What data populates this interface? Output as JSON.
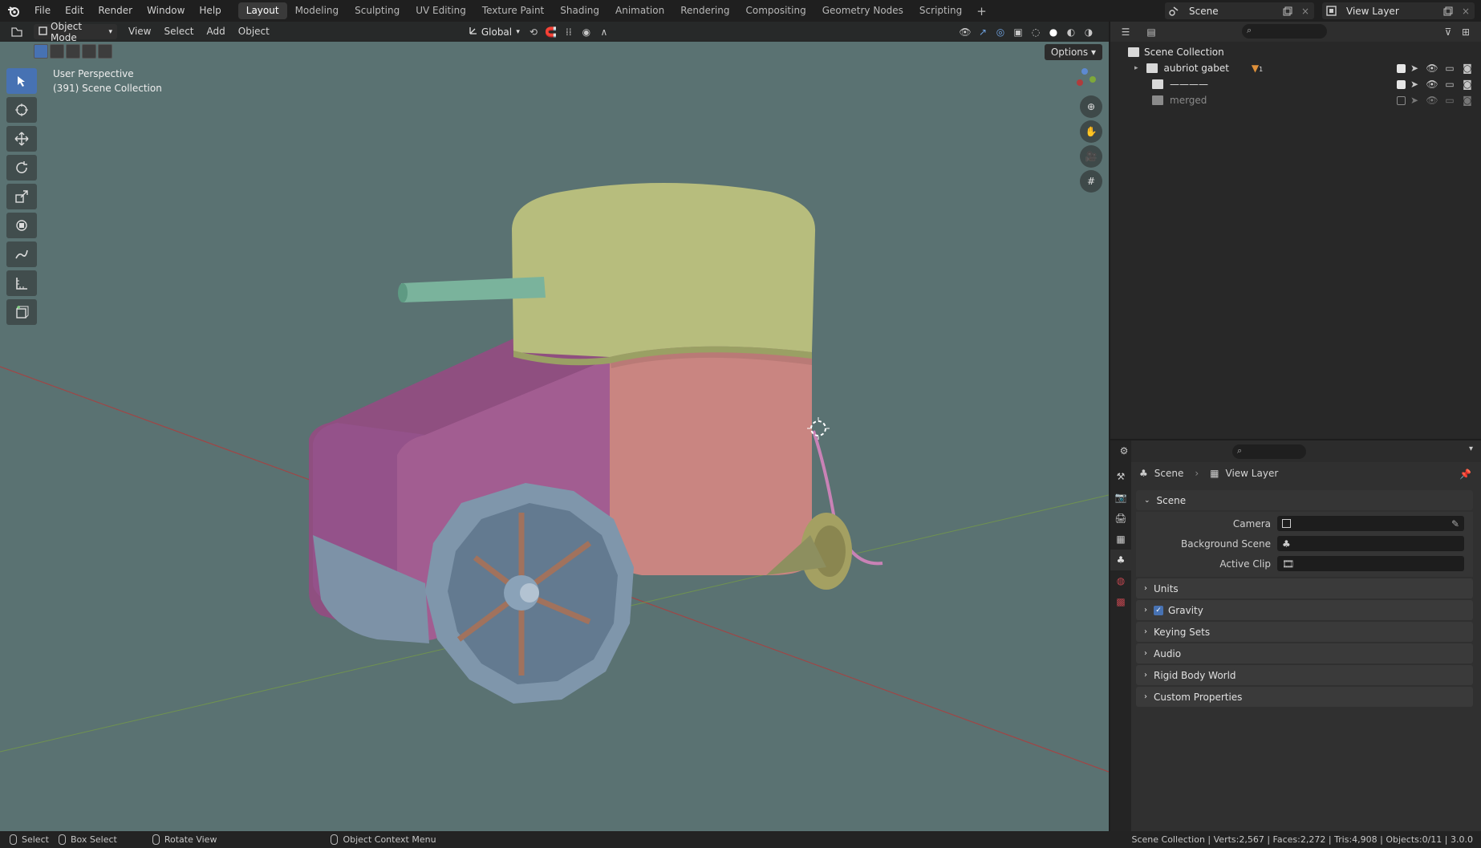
{
  "topbar": {
    "menus": [
      "File",
      "Edit",
      "Render",
      "Window",
      "Help"
    ],
    "workspaces": [
      "Layout",
      "Modeling",
      "Sculpting",
      "UV Editing",
      "Texture Paint",
      "Shading",
      "Animation",
      "Rendering",
      "Compositing",
      "Geometry Nodes",
      "Scripting"
    ],
    "active_workspace": "Layout",
    "add_tab": "+",
    "scene": "Scene",
    "view_layer": "View Layer"
  },
  "viewport": {
    "mode": "Object Mode",
    "menus": [
      "View",
      "Select",
      "Add",
      "Object"
    ],
    "orientation": "Global",
    "options": "Options",
    "perspective": "User Perspective",
    "collection_info": "(391) Scene Collection",
    "background": "#5a7272"
  },
  "outliner": {
    "root": "Scene Collection",
    "items": [
      {
        "name": "aubriot gabet",
        "visible": true,
        "badge": "1"
      },
      {
        "name": "————",
        "visible": true
      },
      {
        "name": "merged",
        "visible": false
      }
    ]
  },
  "properties": {
    "breadcrumb": {
      "scene": "Scene",
      "view_layer": "View Layer"
    },
    "scene_panel": "Scene",
    "fields": [
      {
        "label": "Camera",
        "value": ""
      },
      {
        "label": "Background Scene",
        "value": ""
      },
      {
        "label": "Active Clip",
        "value": ""
      }
    ],
    "panels": [
      "Units",
      "Gravity",
      "Keying Sets",
      "Audio",
      "Rigid Body World",
      "Custom Properties"
    ],
    "gravity_checked": true
  },
  "statusbar": {
    "select": "Select",
    "box_select": "Box Select",
    "rotate_view": "Rotate View",
    "context_menu": "Object Context Menu",
    "stats": "Scene Collection | Verts:2,567 | Faces:2,272 | Tris:4,908 | Objects:0/11 | 3.0.0"
  },
  "colors": {
    "accent": "#4772b3",
    "x_axis": "#b03c3c",
    "y_axis": "#7ea83a",
    "dome": "#b7bd7d",
    "body_pink": "#c98581",
    "box_purple": "#a25d91",
    "wheel_blue": "#7f96ab",
    "spoke": "#a1725d"
  }
}
